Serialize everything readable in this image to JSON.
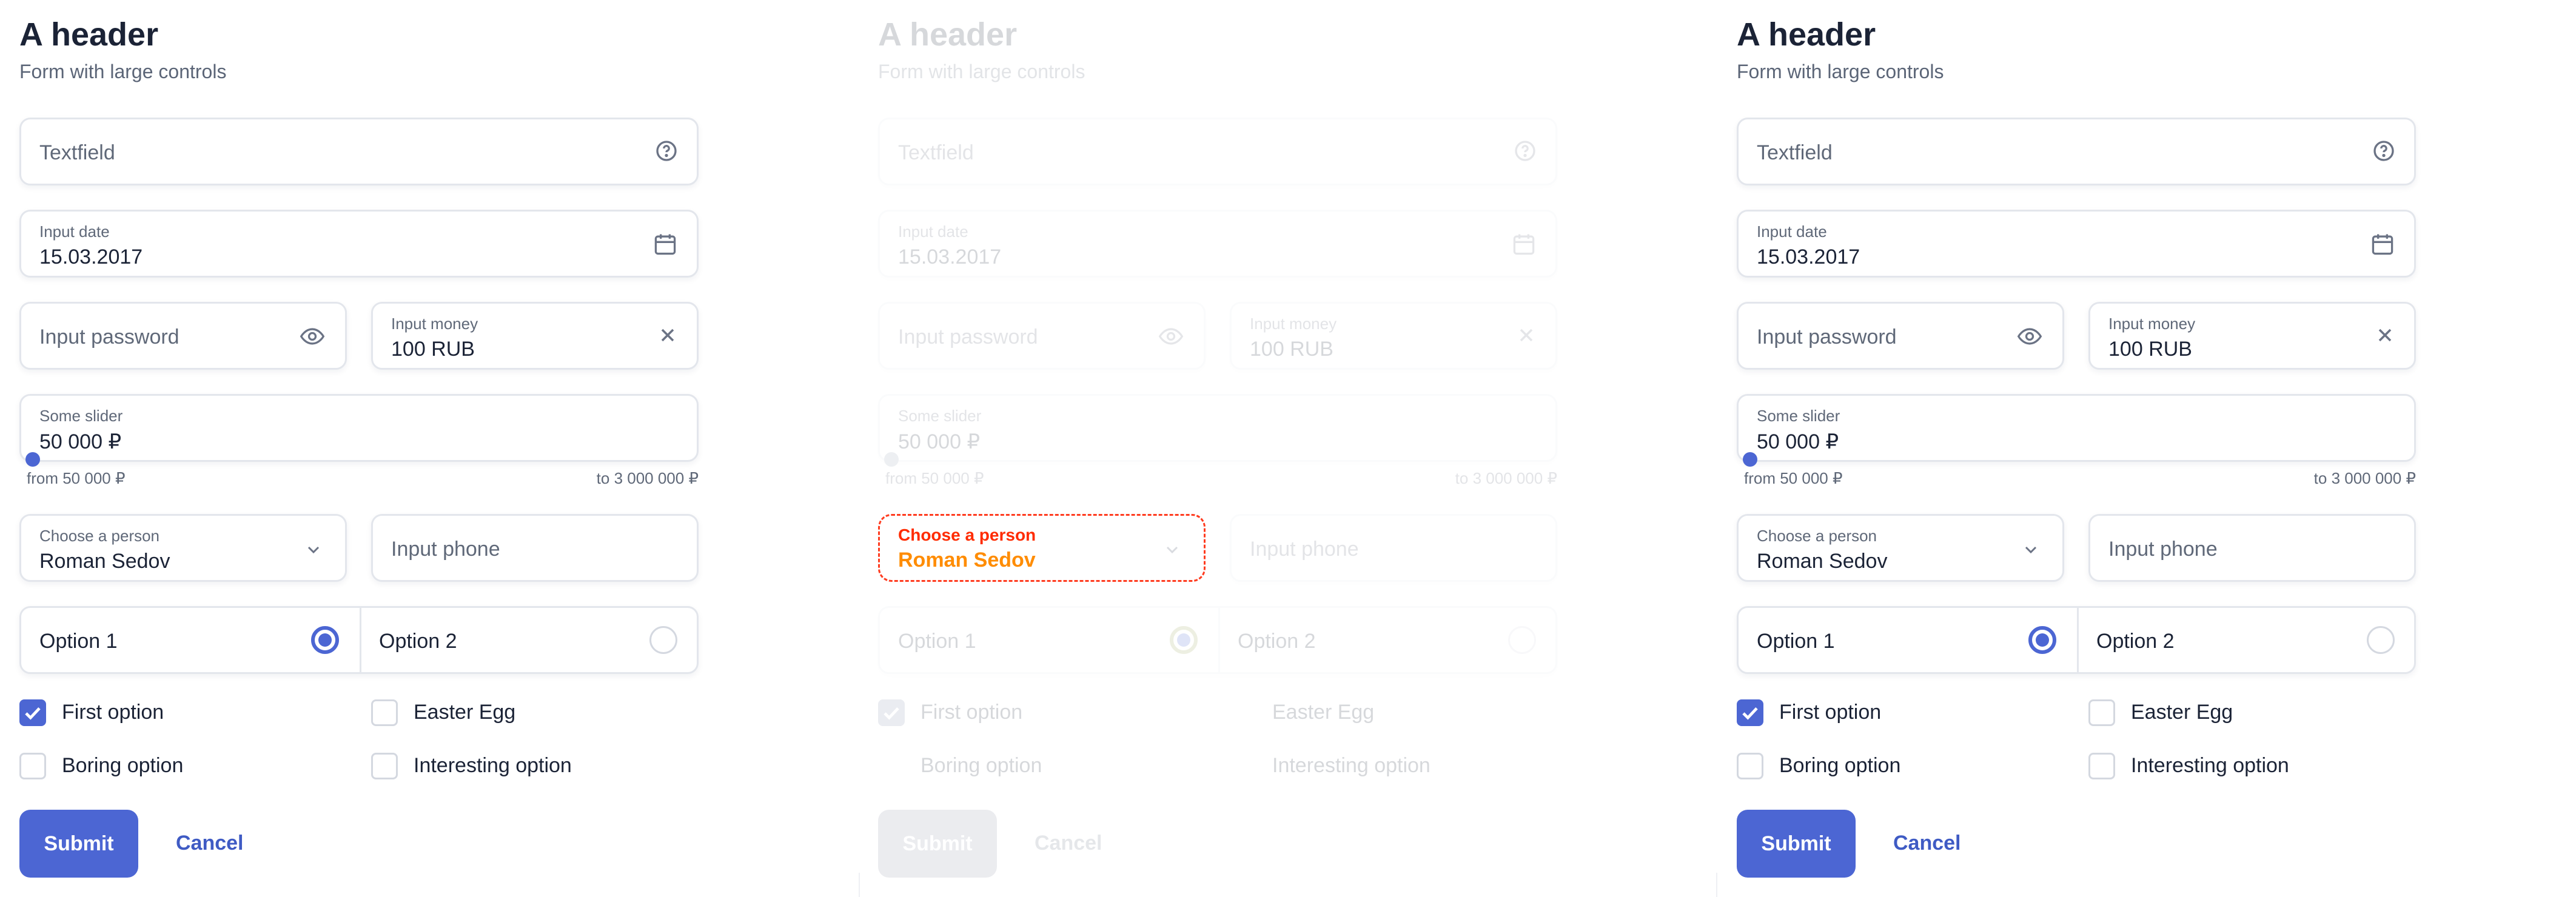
{
  "form": {
    "header": "A header",
    "subheader": "Form with large controls",
    "textfield_placeholder": "Textfield",
    "date": {
      "label": "Input date",
      "value": "15.03.2017"
    },
    "password_placeholder": "Input password",
    "money": {
      "label": "Input money",
      "value": "100 RUB"
    },
    "slider": {
      "label": "Some slider",
      "value": "50 000 ₽",
      "from": "from 50 000 ₽",
      "to": "to 3 000 000 ₽",
      "position": 0
    },
    "person": {
      "label": "Choose a person",
      "value": "Roman Sedov"
    },
    "phone_placeholder": "Input phone",
    "radio": [
      {
        "label": "Option 1",
        "selected": true
      },
      {
        "label": "Option 2",
        "selected": false
      }
    ],
    "checkboxes": [
      {
        "label": "First option",
        "checked": true
      },
      {
        "label": "Easter Egg",
        "checked": false
      },
      {
        "label": "Boring option",
        "checked": false
      },
      {
        "label": "Interesting option",
        "checked": false
      }
    ],
    "submit_label": "Submit",
    "cancel_label": "Cancel"
  },
  "icons": {
    "help": "help-circle-icon",
    "calendar": "calendar-icon",
    "eye": "eye-icon",
    "clear": "close-icon",
    "dropdown": "chevron-down-icon"
  },
  "colors": {
    "accent": "#4c66d3",
    "border": "#e3e6ec",
    "highlight": "#ff3b1f"
  }
}
